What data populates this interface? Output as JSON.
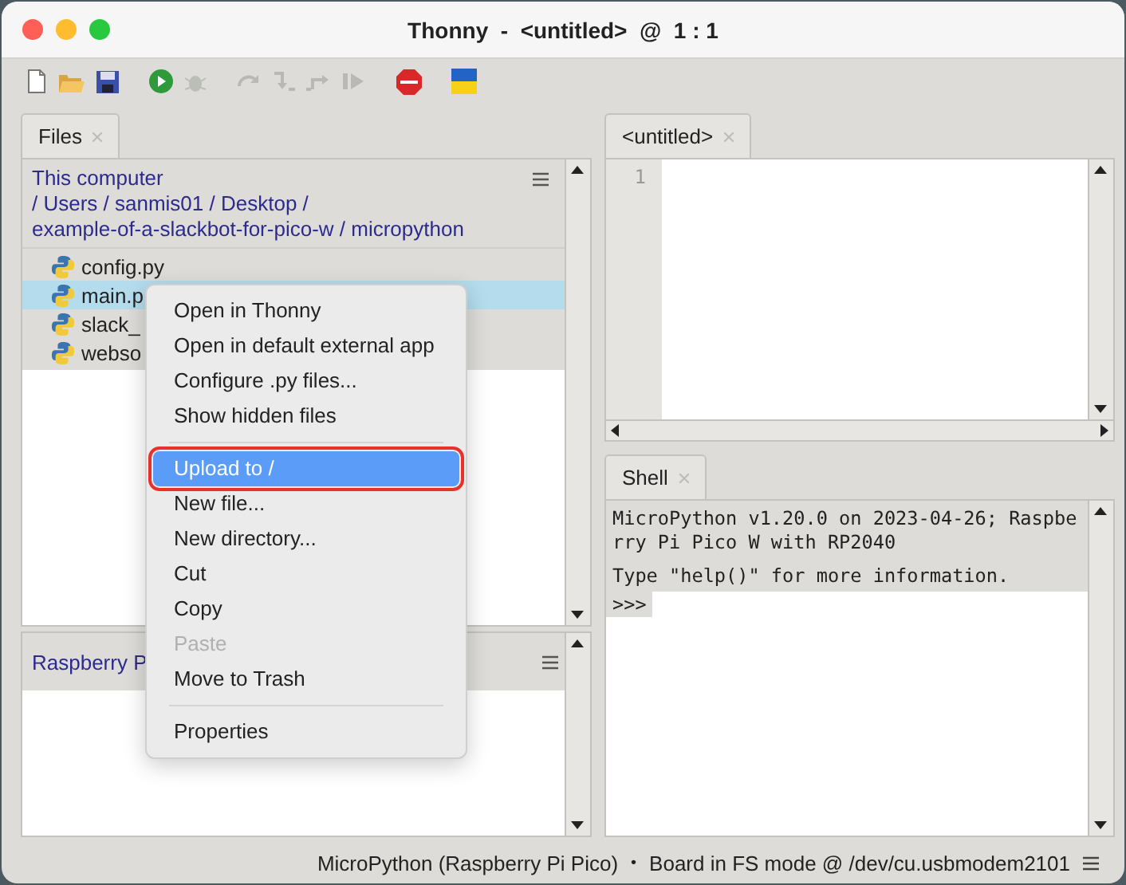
{
  "window": {
    "title": "Thonny  -  <untitled>  @  1 : 1"
  },
  "toolbar": [
    {
      "kind": "new",
      "disabled": false
    },
    {
      "kind": "open",
      "disabled": false
    },
    {
      "kind": "save",
      "disabled": false
    },
    {
      "kind": "run",
      "disabled": false
    },
    {
      "kind": "debug",
      "disabled": true
    },
    {
      "kind": "step-over",
      "disabled": true
    },
    {
      "kind": "step-into",
      "disabled": true
    },
    {
      "kind": "step-out",
      "disabled": true
    },
    {
      "kind": "resume",
      "disabled": true
    },
    {
      "kind": "stop",
      "disabled": false
    },
    {
      "kind": "flag",
      "disabled": false
    }
  ],
  "files_panel": {
    "tab": "Files",
    "location": "This computer",
    "path": [
      "/ Users / sanmis01 / Desktop /",
      "example-of-a-slackbot-for-pico-w / micropython"
    ],
    "files": [
      {
        "name": "config.py",
        "selected": false
      },
      {
        "name": "main.p",
        "selected": true
      },
      {
        "name": "slack_",
        "selected": false
      },
      {
        "name": "webso",
        "selected": false
      }
    ],
    "device_header": "Raspberry P"
  },
  "context_menu": [
    {
      "kind": "item",
      "label": "Open in Thonny",
      "disabled": false,
      "selected": false
    },
    {
      "kind": "item",
      "label": "Open in default external app",
      "disabled": false,
      "selected": false
    },
    {
      "kind": "item",
      "label": "Configure .py files...",
      "disabled": false,
      "selected": false
    },
    {
      "kind": "item",
      "label": "Show hidden files",
      "disabled": false,
      "selected": false
    },
    {
      "kind": "separator"
    },
    {
      "kind": "item",
      "label": "Upload to /",
      "disabled": false,
      "selected": true,
      "outlined": true
    },
    {
      "kind": "item",
      "label": "New file...",
      "disabled": false,
      "selected": false
    },
    {
      "kind": "item",
      "label": "New directory...",
      "disabled": false,
      "selected": false
    },
    {
      "kind": "item",
      "label": "Cut",
      "disabled": false,
      "selected": false
    },
    {
      "kind": "item",
      "label": "Copy",
      "disabled": false,
      "selected": false
    },
    {
      "kind": "item",
      "label": "Paste",
      "disabled": true,
      "selected": false
    },
    {
      "kind": "item",
      "label": "Move to Trash",
      "disabled": false,
      "selected": false
    },
    {
      "kind": "separator"
    },
    {
      "kind": "item",
      "label": "Properties",
      "disabled": false,
      "selected": false
    }
  ],
  "editor": {
    "tab": "<untitled>",
    "line_numbers": [
      "1"
    ]
  },
  "shell": {
    "tab": "Shell",
    "lines": [
      "MicroPython v1.20.0 on 2023-04-26; Raspberry Pi Pico W with RP2040",
      "Type \"help()\" for more information."
    ],
    "prompt": ">>>"
  },
  "status_bar": {
    "interpreter": "MicroPython (Raspberry Pi Pico)",
    "separator": "•",
    "port": "Board in FS mode @ /dev/cu.usbmodem2101"
  }
}
